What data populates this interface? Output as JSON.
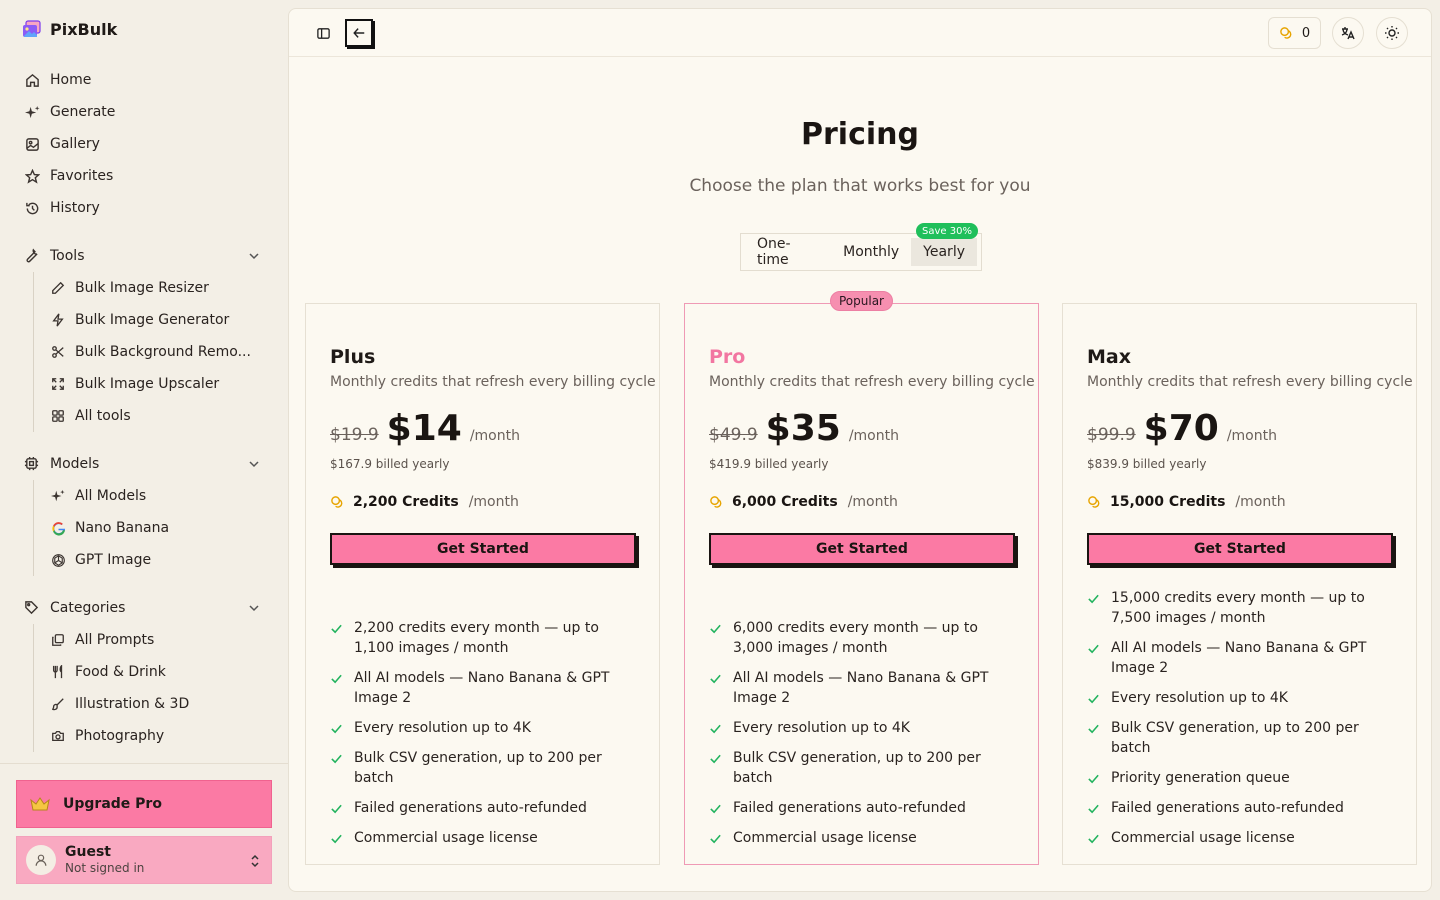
{
  "app": {
    "name": "PixBulk"
  },
  "sidebar": {
    "primary": [
      {
        "label": "Home",
        "icon": "home-icon"
      },
      {
        "label": "Generate",
        "icon": "sparkles-icon"
      },
      {
        "label": "Gallery",
        "icon": "image-icon"
      },
      {
        "label": "Favorites",
        "icon": "star-icon"
      },
      {
        "label": "History",
        "icon": "history-icon"
      }
    ],
    "tools": {
      "label": "Tools",
      "items": [
        {
          "label": "Bulk Image Resizer",
          "icon": "pencil-icon"
        },
        {
          "label": "Bulk Image Generator",
          "icon": "lightning-icon"
        },
        {
          "label": "Bulk Background Remo...",
          "icon": "scissors-icon"
        },
        {
          "label": "Bulk Image Upscaler",
          "icon": "expand-icon"
        },
        {
          "label": "All tools",
          "icon": "grid-icon"
        }
      ]
    },
    "models": {
      "label": "Models",
      "items": [
        {
          "label": "All Models",
          "icon": "sparkles-icon"
        },
        {
          "label": "Nano Banana",
          "icon": "google-icon"
        },
        {
          "label": "GPT Image",
          "icon": "openai-icon"
        }
      ]
    },
    "categories": {
      "label": "Categories",
      "items": [
        {
          "label": "All Prompts",
          "icon": "stack-icon"
        },
        {
          "label": "Food & Drink",
          "icon": "utensils-icon"
        },
        {
          "label": "Illustration & 3D",
          "icon": "brush-icon"
        },
        {
          "label": "Photography",
          "icon": "camera-icon"
        }
      ]
    },
    "upgrade_label": "Upgrade Pro",
    "user": {
      "name": "Guest",
      "status": "Not signed in"
    }
  },
  "topbar": {
    "credits": "0"
  },
  "pricing": {
    "title": "Pricing",
    "subtitle": "Choose the plan that works best for you",
    "toggle": {
      "options": [
        "One-time",
        "Monthly",
        "Yearly"
      ],
      "selected": "Yearly",
      "badge": "Save 30%"
    },
    "popular_badge": "Popular",
    "plans": [
      {
        "name": "Plus",
        "description": "Monthly credits that refresh every billing cycle",
        "old_price": "$19.9",
        "price": "$14",
        "per": "/month",
        "billed": "$167.9 billed yearly",
        "credits": "2,200 Credits",
        "credits_per": "/month",
        "cta": "Get Started",
        "features": [
          "2,200 credits every month — up to 1,100 images / month",
          "All AI models — Nano Banana & GPT Image 2",
          "Every resolution up to 4K",
          "Bulk CSV generation, up to 200 per batch",
          "Failed generations auto-refunded",
          "Commercial usage license"
        ]
      },
      {
        "name": "Pro",
        "description": "Monthly credits that refresh every billing cycle",
        "old_price": "$49.9",
        "price": "$35",
        "per": "/month",
        "billed": "$419.9 billed yearly",
        "credits": "6,000 Credits",
        "credits_per": "/month",
        "cta": "Get Started",
        "features": [
          "6,000 credits every month — up to 3,000 images / month",
          "All AI models — Nano Banana & GPT Image 2",
          "Every resolution up to 4K",
          "Bulk CSV generation, up to 200 per batch",
          "Failed generations auto-refunded",
          "Commercial usage license"
        ]
      },
      {
        "name": "Max",
        "description": "Monthly credits that refresh every billing cycle",
        "old_price": "$99.9",
        "price": "$70",
        "per": "/month",
        "billed": "$839.9 billed yearly",
        "credits": "15,000 Credits",
        "credits_per": "/month",
        "cta": "Get Started",
        "features": [
          "15,000 credits every month — up to 7,500 images / month",
          "All AI models — Nano Banana & GPT Image 2",
          "Every resolution up to 4K",
          "Bulk CSV generation, up to 200 per batch",
          "Priority generation queue",
          "Failed generations auto-refunded",
          "Commercial usage license"
        ]
      }
    ]
  },
  "colors": {
    "accent_pink": "#fb7aa4",
    "pro_name": "#f276a1",
    "check_green": "#22b35e",
    "save_badge": "#1fbf5b",
    "background": "#f3efe6",
    "panel": "#fcf9f1"
  }
}
